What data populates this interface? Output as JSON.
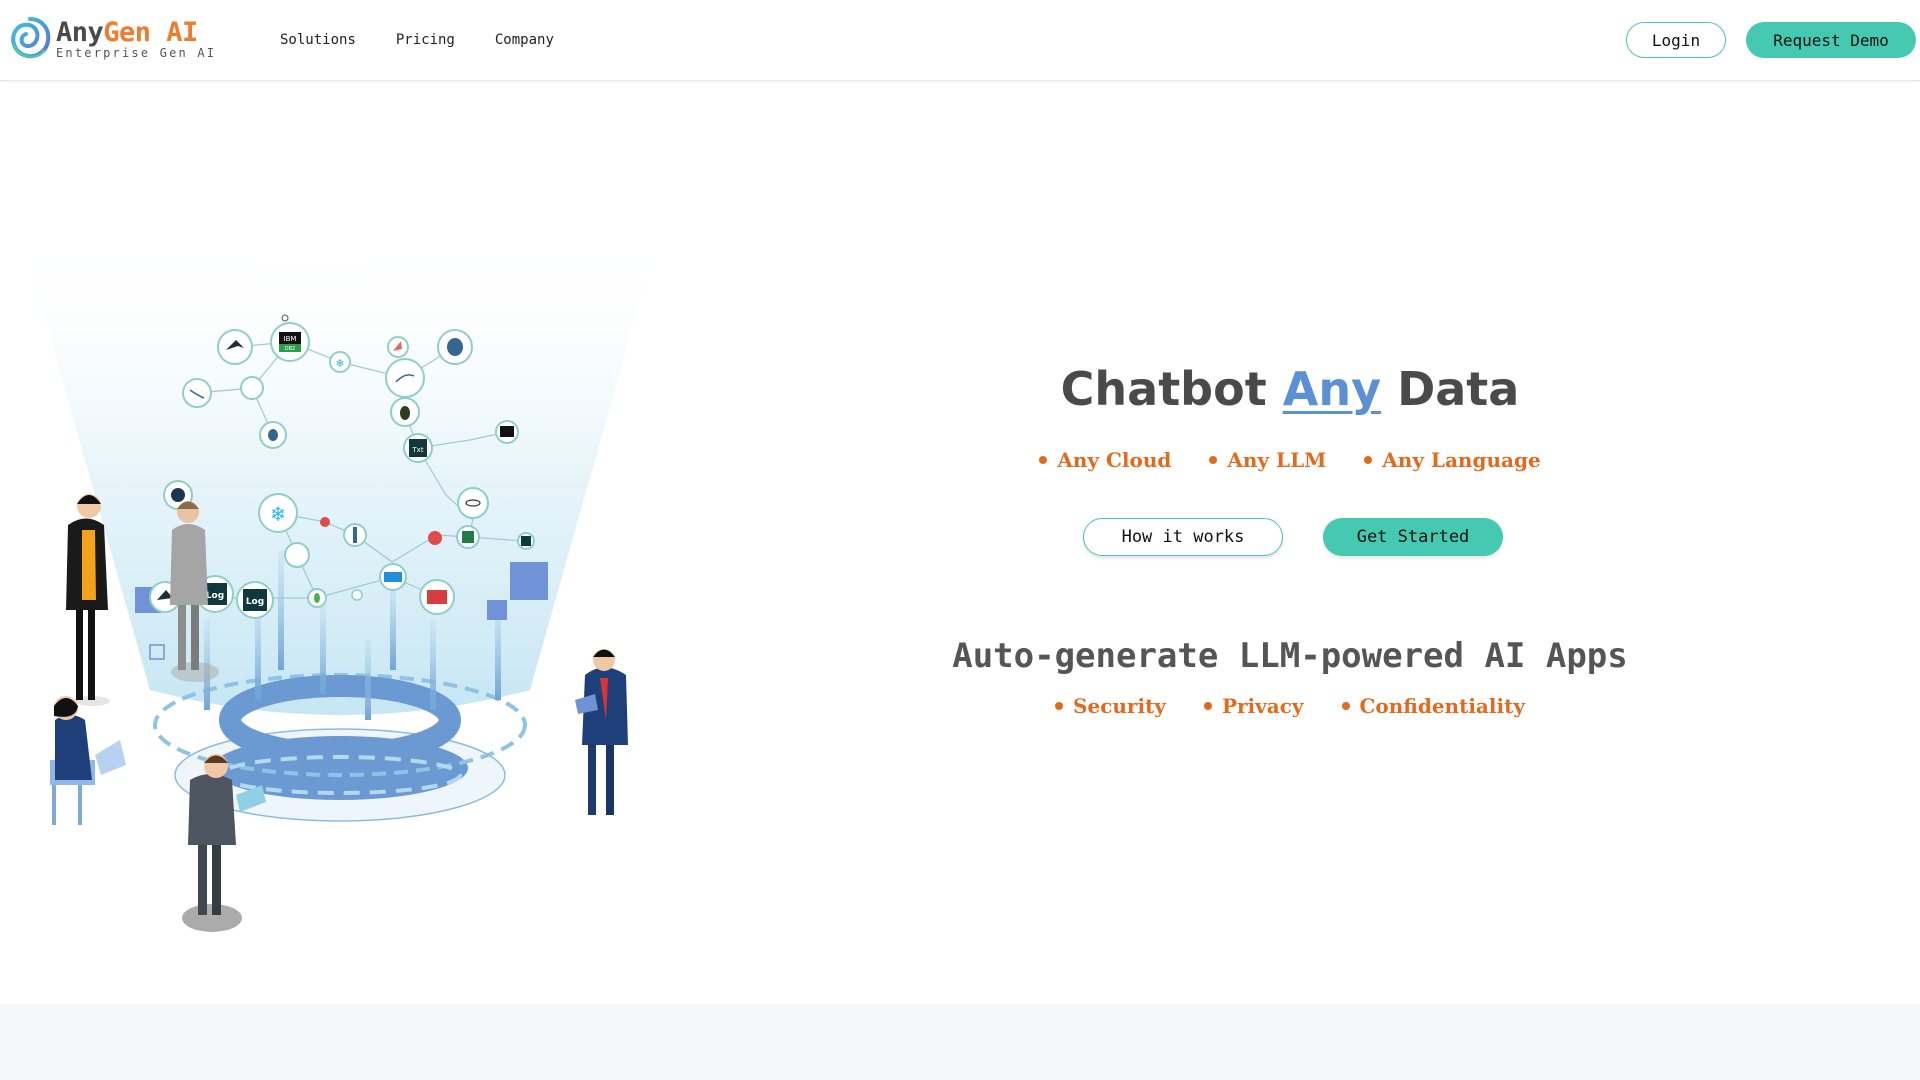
{
  "brand": {
    "name_part1": "Any",
    "name_part2": "Gen AI",
    "tagline": "Enterprise Gen AI",
    "colors": {
      "dark": "#4a4a4a",
      "orange": "#ef7c2e",
      "teal": "#46c9b1",
      "blue": "#5b8fd6"
    }
  },
  "nav": {
    "items": [
      {
        "label": "Solutions"
      },
      {
        "label": "Pricing"
      },
      {
        "label": "Company"
      }
    ]
  },
  "header": {
    "login_label": "Login",
    "demo_label": "Request Demo"
  },
  "hero": {
    "title_before": "Chatbot",
    "title_accent": "Any",
    "title_after": "Data",
    "bullets": [
      "Any Cloud",
      "Any LLM",
      "Any Language"
    ],
    "how_label": "How it works",
    "start_label": "Get Started",
    "subtitle": "Auto-generate LLM-powered AI Apps",
    "sub_bullets": [
      "Security",
      "Privacy",
      "Confidentiality"
    ]
  },
  "illustration": {
    "labels": {
      "ibm": "IBM",
      "db2": "DB2",
      "log": "Log",
      "txt": "Txt"
    }
  }
}
